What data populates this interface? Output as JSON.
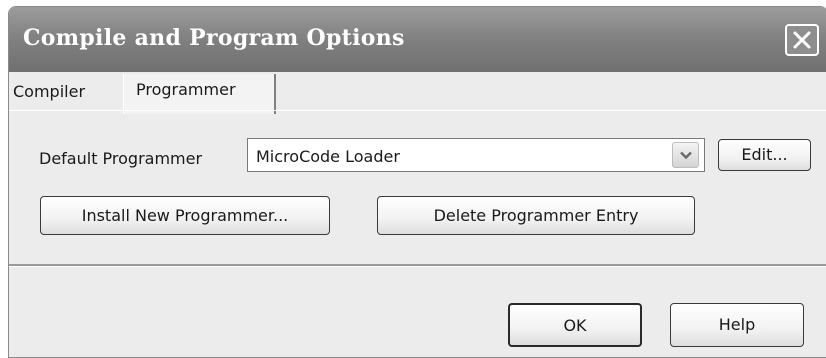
{
  "window": {
    "title": "Compile and Program Options"
  },
  "tabs": [
    {
      "label": "Compiler",
      "active": false
    },
    {
      "label": "Programmer",
      "active": true
    }
  ],
  "programmer": {
    "default_label": "Default Programmer",
    "selected": "MicroCode Loader",
    "edit_label": "Edit...",
    "install_label": "Install New Programmer...",
    "delete_label": "Delete Programmer Entry"
  },
  "footer": {
    "ok_label": "OK",
    "help_label": "Help"
  },
  "icons": {
    "close": "close-icon",
    "dropdown": "chevron-down-icon"
  }
}
